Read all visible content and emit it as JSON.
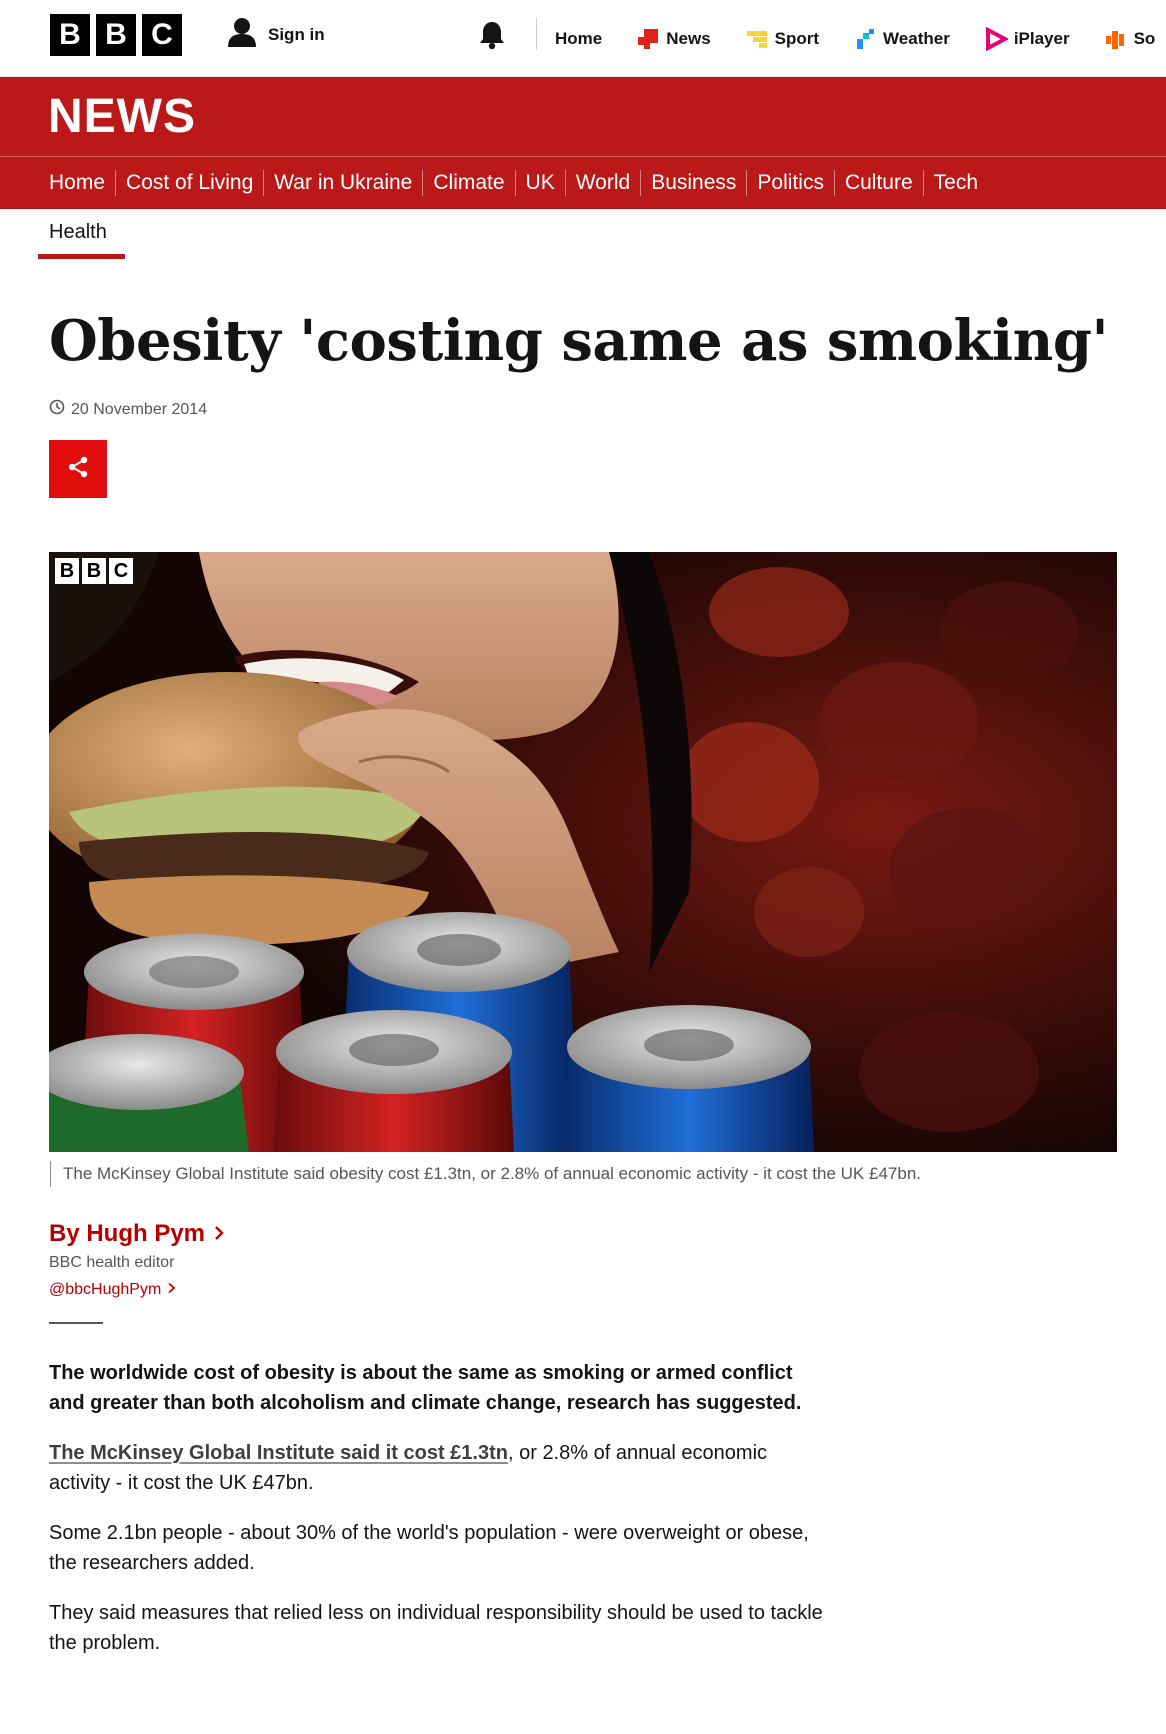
{
  "topbar": {
    "logo_letters": [
      "B",
      "B",
      "C"
    ],
    "signin_label": "Sign in",
    "nav": [
      {
        "label": "Home",
        "icon": "none"
      },
      {
        "label": "News",
        "icon": "news-icon",
        "color": "#e2231a"
      },
      {
        "label": "Sport",
        "icon": "sport-icon",
        "color": "#ffd230"
      },
      {
        "label": "Weather",
        "icon": "weather-icon",
        "color": "#1e90ff"
      },
      {
        "label": "iPlayer",
        "icon": "iplayer-icon",
        "color": "#e6007e"
      },
      {
        "label": "So",
        "icon": "sounds-icon",
        "color": "#ff6600"
      }
    ]
  },
  "news_banner": {
    "word": "NEWS",
    "color": "#bb1919"
  },
  "section_nav": [
    "Home",
    "Cost of Living",
    "War in Ukraine",
    "Climate",
    "UK",
    "World",
    "Business",
    "Politics",
    "Culture",
    "Tech"
  ],
  "sub_nav": {
    "active": "Health"
  },
  "article": {
    "headline": "Obesity 'costing same as smoking'",
    "date": "20 November 2014",
    "image_watermark": [
      "B",
      "B",
      "C"
    ],
    "caption": "The McKinsey Global Institute said obesity cost £1.3tn, or 2.8% of annual economic activity - it cost the UK £47bn.",
    "byline": {
      "name": "By Hugh Pym",
      "role": "BBC health editor",
      "handle": "@bbcHughPym"
    },
    "paragraphs": {
      "lead": "The worldwide cost of obesity is about the same as smoking or armed conflict and greater than both alcoholism and climate change, research has suggested.",
      "p2_link": "The McKinsey Global Institute said it cost £1.3tn",
      "p2_rest": ", or 2.8% of annual economic activity - it cost the UK £47bn.",
      "p3": "Some 2.1bn people - about 30% of the world's population - were overweight or obese, the researchers added.",
      "p4": "They said measures that relied less on individual responsibility should be used to tackle the problem."
    }
  },
  "colors": {
    "accent": "#bb1919",
    "share": "#e20d0d",
    "byline": "#b80000"
  }
}
